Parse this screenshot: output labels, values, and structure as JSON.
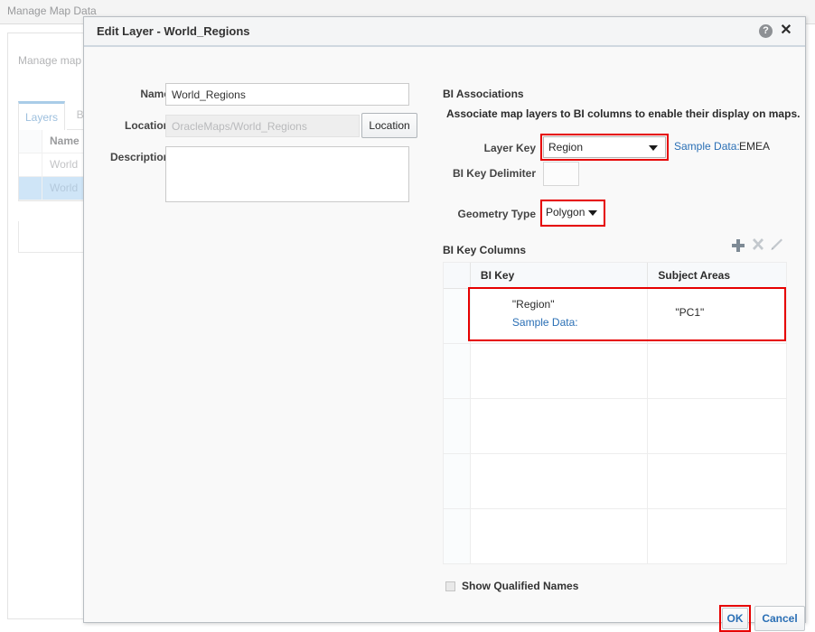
{
  "background": {
    "window_title": "Manage Map Data",
    "subtitle": "Manage map",
    "tabs": [
      {
        "label": "Layers",
        "active": true
      },
      {
        "label": "Ba",
        "active": false
      }
    ],
    "table": {
      "header": "Name",
      "rows": [
        {
          "name": "World",
          "selected": false
        },
        {
          "name": "World",
          "selected": true
        }
      ]
    }
  },
  "dialog": {
    "title": "Edit Layer - World_Regions",
    "help_icon": "help-icon",
    "help_glyph": "?",
    "close_icon": "close-icon",
    "close_glyph": "✕",
    "form": {
      "name_label": "Name",
      "name_value": "World_Regions",
      "location_label": "Location",
      "location_value": "OracleMaps/World_Regions",
      "location_button": "Location",
      "description_label": "Description",
      "description_value": ""
    },
    "bi_associations": {
      "title": "BI Associations",
      "description": "Associate map layers to BI columns to enable their display on maps.",
      "layer_key_label": "Layer Key",
      "layer_key_value": "Region",
      "sample_data_link": "Sample Data:",
      "sample_data_value": "EMEA",
      "delimiter_label": "BI Key Delimiter",
      "delimiter_value": "",
      "geometry_type_label": "Geometry Type",
      "geometry_type_value": "Polygon"
    },
    "bi_key_columns": {
      "title": "BI Key Columns",
      "toolbar": [
        {
          "name": "add-icon",
          "glyph": "+"
        },
        {
          "name": "delete-icon",
          "glyph": "✕"
        },
        {
          "name": "edit-icon",
          "glyph": "✎"
        }
      ],
      "columns": [
        "BI Key",
        "Subject Areas"
      ],
      "rows": [
        {
          "bi_key": "\"Region\"",
          "sample_data": "Sample Data:",
          "subject_areas": "\"PC1\"",
          "highlighted": true
        },
        {
          "bi_key": "",
          "sample_data": "",
          "subject_areas": "",
          "highlighted": false
        },
        {
          "bi_key": "",
          "sample_data": "",
          "subject_areas": "",
          "highlighted": false
        },
        {
          "bi_key": "",
          "sample_data": "",
          "subject_areas": "",
          "highlighted": false
        },
        {
          "bi_key": "",
          "sample_data": "",
          "subject_areas": "",
          "highlighted": false
        }
      ]
    },
    "footer": {
      "show_qualified_names_label": "Show Qualified Names",
      "show_qualified_names_checked": false,
      "ok_label": "OK",
      "cancel_label": "Cancel"
    }
  },
  "colors": {
    "highlight_red": "#e60000",
    "link_blue": "#2a6fb5",
    "button_text_blue": "#2a6fb5",
    "selected_row_blue": "#cfe5f7",
    "header_border_blue": "#cfd8e0"
  }
}
